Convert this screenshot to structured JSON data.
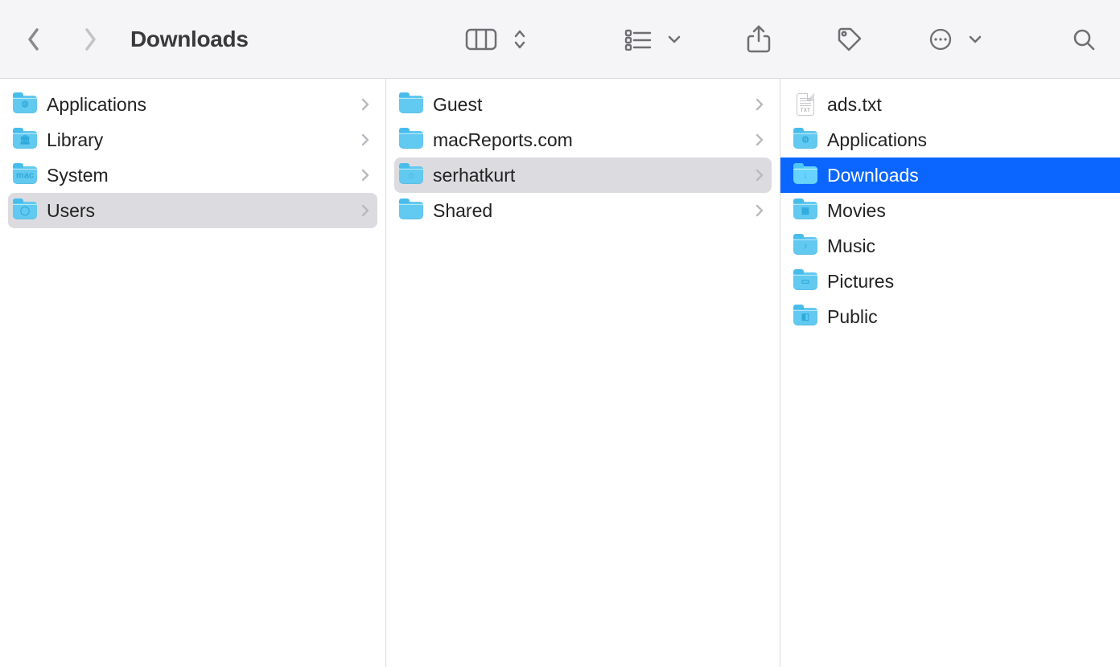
{
  "title": "Downloads",
  "columns": [
    {
      "items": [
        {
          "label": "Applications",
          "type": "folder",
          "glyph": "⚙",
          "expandable": true,
          "state": "normal"
        },
        {
          "label": "Library",
          "type": "folder",
          "glyph": "🏛",
          "expandable": true,
          "state": "normal"
        },
        {
          "label": "System",
          "type": "folder",
          "glyph": "mac",
          "expandable": true,
          "state": "normal"
        },
        {
          "label": "Users",
          "type": "folder",
          "glyph": "◯",
          "expandable": true,
          "state": "path-selected"
        }
      ]
    },
    {
      "items": [
        {
          "label": "Guest",
          "type": "folder",
          "glyph": "",
          "expandable": true,
          "state": "normal"
        },
        {
          "label": "macReports.com",
          "type": "folder",
          "glyph": "",
          "expandable": true,
          "state": "normal"
        },
        {
          "label": "serhatkurt",
          "type": "folder",
          "glyph": "⌂",
          "expandable": true,
          "state": "path-selected"
        },
        {
          "label": "Shared",
          "type": "folder",
          "glyph": "",
          "expandable": true,
          "state": "normal"
        }
      ]
    },
    {
      "items": [
        {
          "label": "ads.txt",
          "type": "txt",
          "glyph": "TXT",
          "expandable": false,
          "state": "normal"
        },
        {
          "label": "Applications",
          "type": "folder",
          "glyph": "⚙",
          "expandable": false,
          "state": "normal"
        },
        {
          "label": "Downloads",
          "type": "folder",
          "glyph": "↓",
          "expandable": false,
          "state": "selected"
        },
        {
          "label": "Movies",
          "type": "folder",
          "glyph": "▦",
          "expandable": false,
          "state": "normal"
        },
        {
          "label": "Music",
          "type": "folder",
          "glyph": "♪",
          "expandable": false,
          "state": "normal"
        },
        {
          "label": "Pictures",
          "type": "folder",
          "glyph": "▭",
          "expandable": false,
          "state": "normal"
        },
        {
          "label": "Public",
          "type": "folder",
          "glyph": "◧",
          "expandable": false,
          "state": "normal"
        }
      ]
    }
  ]
}
